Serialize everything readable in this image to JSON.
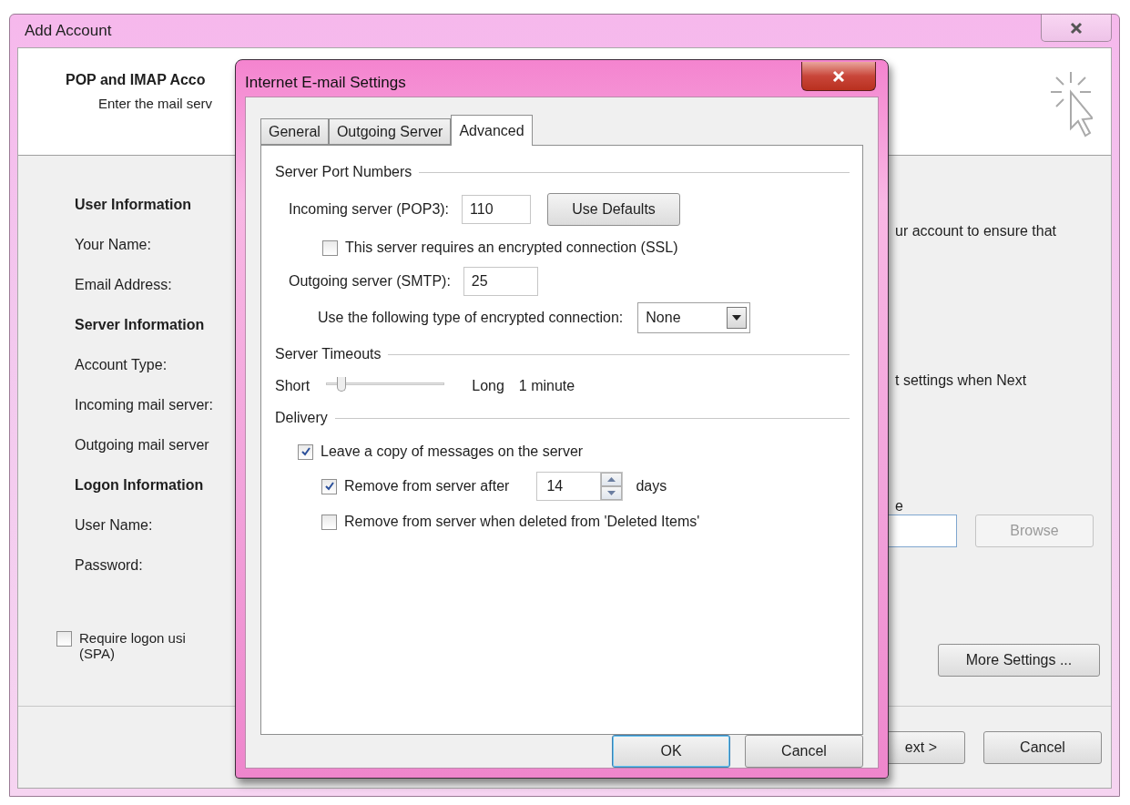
{
  "window": {
    "title": "Add Account"
  },
  "header": {
    "title": "POP and IMAP Acco",
    "subtitle": "Enter the mail serv"
  },
  "left_sections": [
    {
      "heading": "User Information",
      "labels": [
        "Your Name:",
        "Email Address:"
      ]
    },
    {
      "heading": "Server Information",
      "labels": [
        "Account Type:",
        "Incoming mail server:",
        "Outgoing mail server"
      ]
    },
    {
      "heading": "Logon Information",
      "labels": [
        "User Name:",
        "Password:"
      ]
    }
  ],
  "spa_checkbox": {
    "label": "Require logon usi",
    "label_2": "(SPA)",
    "checked": false
  },
  "right_texts": [
    "ur account to ensure that",
    "t settings when Next",
    "e"
  ],
  "browse_button": {
    "label": "Browse",
    "disabled": true
  },
  "more_settings_button": {
    "label": "More Settings ..."
  },
  "footer_buttons": [
    {
      "label": "ext >"
    },
    {
      "label": "Cancel"
    }
  ],
  "dialog": {
    "title": "Internet E-mail Settings",
    "tabs": [
      {
        "label": "General",
        "selected": false
      },
      {
        "label": "Outgoing Server",
        "selected": false
      },
      {
        "label": "Advanced",
        "selected": true
      }
    ],
    "port_numbers": {
      "heading": "Server Port Numbers",
      "incoming": {
        "label": "Incoming server (POP3):",
        "value": "110"
      },
      "use_defaults": "Use Defaults",
      "ssl": {
        "label": "This server requires an encrypted connection (SSL)",
        "checked": false
      },
      "outgoing": {
        "label": "Outgoing server (SMTP):",
        "value": "25"
      },
      "encryption": {
        "label": "Use the following type of encrypted connection:",
        "value": "None"
      }
    },
    "timeouts": {
      "heading": "Server Timeouts",
      "short_label": "Short",
      "level": 0.1,
      "long_label": "Long",
      "reading": "1 minute"
    },
    "delivery": {
      "heading": "Delivery",
      "options": [
        {
          "kind": "checkbox",
          "label": "Leave a copy of messages on the server",
          "checked": true,
          "children": [
            {
              "kind": "spinner",
              "label": "Remove from server after",
              "checked": true,
              "value": "14",
              "unit": "days"
            },
            {
              "kind": "checkbox",
              "label": "Remove from server when deleted from 'Deleted Items'",
              "checked": false
            }
          ]
        }
      ]
    },
    "buttons": [
      {
        "label": "OK",
        "default": true
      },
      {
        "label": "Cancel",
        "default": false
      }
    ]
  }
}
